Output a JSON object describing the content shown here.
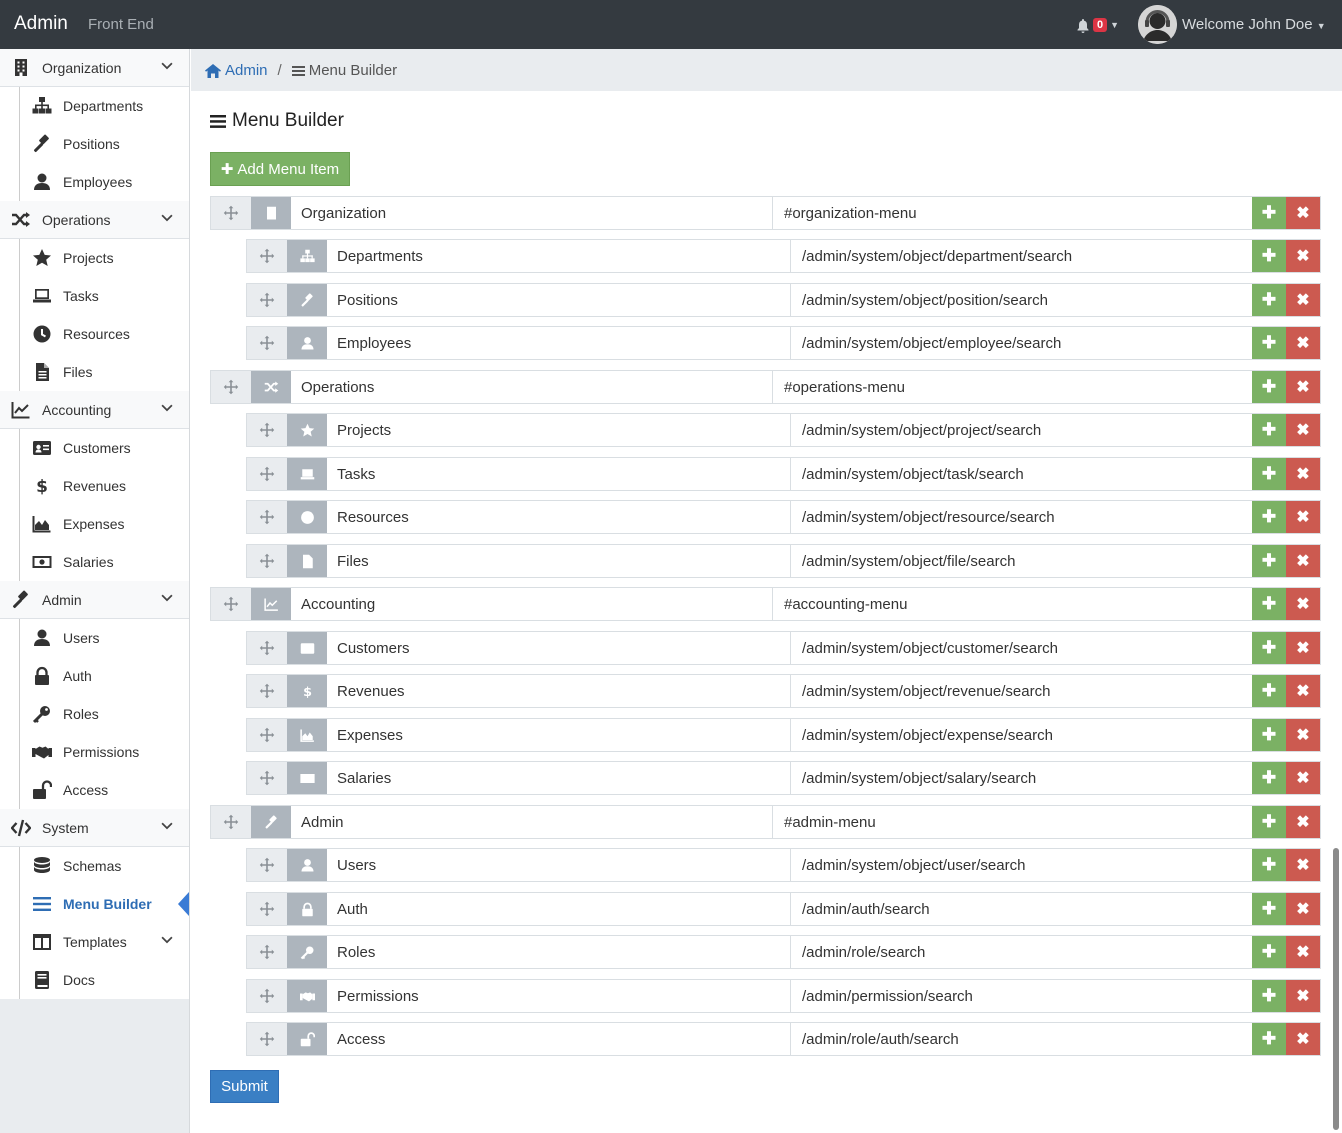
{
  "topbar": {
    "brand": "Admin",
    "frontend": "Front End",
    "notification_count": "0",
    "welcome": "Welcome John Doe"
  },
  "sidebar": {
    "groups": [
      {
        "label": "Organization",
        "icon": "building-icon",
        "items": [
          {
            "label": "Departments",
            "icon": "sitemap-icon"
          },
          {
            "label": "Positions",
            "icon": "gavel-icon"
          },
          {
            "label": "Employees",
            "icon": "user-icon"
          }
        ]
      },
      {
        "label": "Operations",
        "icon": "random-icon",
        "items": [
          {
            "label": "Projects",
            "icon": "star-icon"
          },
          {
            "label": "Tasks",
            "icon": "laptop-icon"
          },
          {
            "label": "Resources",
            "icon": "clock-icon"
          },
          {
            "label": "Files",
            "icon": "file-icon"
          }
        ]
      },
      {
        "label": "Accounting",
        "icon": "line-chart-icon",
        "items": [
          {
            "label": "Customers",
            "icon": "id-card-icon"
          },
          {
            "label": "Revenues",
            "icon": "dollar-icon"
          },
          {
            "label": "Expenses",
            "icon": "area-chart-icon"
          },
          {
            "label": "Salaries",
            "icon": "money-icon"
          }
        ]
      },
      {
        "label": "Admin",
        "icon": "gavel-icon",
        "items": [
          {
            "label": "Users",
            "icon": "user-icon"
          },
          {
            "label": "Auth",
            "icon": "lock-icon"
          },
          {
            "label": "Roles",
            "icon": "key-icon"
          },
          {
            "label": "Permissions",
            "icon": "handshake-icon"
          },
          {
            "label": "Access",
            "icon": "unlock-icon"
          }
        ]
      },
      {
        "label": "System",
        "icon": "code-icon",
        "items": [
          {
            "label": "Schemas",
            "icon": "database-icon"
          },
          {
            "label": "Menu Builder",
            "icon": "bars-icon",
            "active": true
          },
          {
            "label": "Templates",
            "icon": "columns-icon",
            "has_children": true
          },
          {
            "label": "Docs",
            "icon": "book-icon"
          }
        ]
      }
    ]
  },
  "breadcrumb": {
    "home": "Admin",
    "current": "Menu Builder"
  },
  "page_title": "Menu Builder",
  "add_button": "Add Menu Item",
  "submit_button": "Submit",
  "menu": [
    {
      "label": "Organization",
      "url": "#organization-menu",
      "level": 0,
      "icon": "building-icon"
    },
    {
      "label": "Departments",
      "url": "/admin/system/object/department/search",
      "level": 1,
      "icon": "sitemap-icon"
    },
    {
      "label": "Positions",
      "url": "/admin/system/object/position/search",
      "level": 1,
      "icon": "gavel-icon"
    },
    {
      "label": "Employees",
      "url": "/admin/system/object/employee/search",
      "level": 1,
      "icon": "user-icon"
    },
    {
      "label": "Operations",
      "url": "#operations-menu",
      "level": 0,
      "icon": "random-icon"
    },
    {
      "label": "Projects",
      "url": "/admin/system/object/project/search",
      "level": 1,
      "icon": "star-icon"
    },
    {
      "label": "Tasks",
      "url": "/admin/system/object/task/search",
      "level": 1,
      "icon": "laptop-icon"
    },
    {
      "label": "Resources",
      "url": "/admin/system/object/resource/search",
      "level": 1,
      "icon": "clock-icon"
    },
    {
      "label": "Files",
      "url": "/admin/system/object/file/search",
      "level": 1,
      "icon": "file-icon"
    },
    {
      "label": "Accounting",
      "url": "#accounting-menu",
      "level": 0,
      "icon": "line-chart-icon"
    },
    {
      "label": "Customers",
      "url": "/admin/system/object/customer/search",
      "level": 1,
      "icon": "id-card-icon"
    },
    {
      "label": "Revenues",
      "url": "/admin/system/object/revenue/search",
      "level": 1,
      "icon": "dollar-icon"
    },
    {
      "label": "Expenses",
      "url": "/admin/system/object/expense/search",
      "level": 1,
      "icon": "area-chart-icon"
    },
    {
      "label": "Salaries",
      "url": "/admin/system/object/salary/search",
      "level": 1,
      "icon": "money-icon"
    },
    {
      "label": "Admin",
      "url": "#admin-menu",
      "level": 0,
      "icon": "gavel-icon"
    },
    {
      "label": "Users",
      "url": "/admin/system/object/user/search",
      "level": 1,
      "icon": "user-icon"
    },
    {
      "label": "Auth",
      "url": "/admin/auth/search",
      "level": 1,
      "icon": "lock-icon"
    },
    {
      "label": "Roles",
      "url": "/admin/role/search",
      "level": 1,
      "icon": "key-icon"
    },
    {
      "label": "Permissions",
      "url": "/admin/permission/search",
      "level": 1,
      "icon": "handshake-icon"
    },
    {
      "label": "Access",
      "url": "/admin/role/auth/search",
      "level": 1,
      "icon": "unlock-icon"
    }
  ],
  "colors": {
    "topbar": "#343a40",
    "add": "#7bb164",
    "delete": "#cc5a50",
    "primary": "#3a7fc4",
    "link": "#2e6db4"
  }
}
